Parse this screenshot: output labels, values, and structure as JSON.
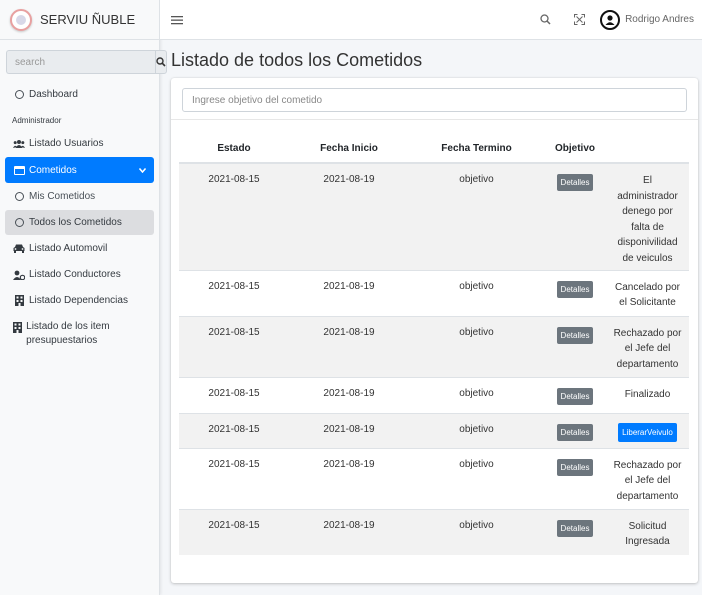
{
  "brand": {
    "name": "SERVIU ÑUBLE"
  },
  "search": {
    "placeholder": "search"
  },
  "sidebar": {
    "items": [
      {
        "label": "Dashboard"
      },
      {
        "header": "Administrador"
      },
      {
        "label": "Listado Usuarios"
      },
      {
        "label": "Cometidos"
      },
      {
        "label": "Mis Cometidos"
      },
      {
        "label": "Todos los Cometidos"
      },
      {
        "label": "Listado Automovil"
      },
      {
        "label": "Listado Conductores"
      },
      {
        "label": "Listado Dependencias"
      },
      {
        "label": "Listado de los item presupuestarios"
      }
    ]
  },
  "topbar": {
    "user_name": "Rodrigo Andres"
  },
  "page": {
    "title": "Listado de todos los Cometidos"
  },
  "filter": {
    "placeholder": "Ingrese objetivo del cometido"
  },
  "table": {
    "headers": [
      "Estado",
      "Fecha Inicio",
      "Fecha Termino",
      "Objetivo",
      ""
    ],
    "rows": [
      {
        "estado": "2021-08-15",
        "inicio": "2021-08-19",
        "termino": "objetivo",
        "button": "Detalles",
        "status": "El administrador denego por falta de disponivilidad de veiculos"
      },
      {
        "estado": "2021-08-15",
        "inicio": "2021-08-19",
        "termino": "objetivo",
        "button": "Detalles",
        "status": "Cancelado por el Solicitante"
      },
      {
        "estado": "2021-08-15",
        "inicio": "2021-08-19",
        "termino": "objetivo",
        "button": "Detalles",
        "status": "Rechazado por el Jefe del departamento"
      },
      {
        "estado": "2021-08-15",
        "inicio": "2021-08-19",
        "termino": "objetivo",
        "button": "Detalles",
        "status": "Finalizado"
      },
      {
        "estado": "2021-08-15",
        "inicio": "2021-08-19",
        "termino": "objetivo",
        "button": "Detalles",
        "action": "LiberarVeivulo"
      },
      {
        "estado": "2021-08-15",
        "inicio": "2021-08-19",
        "termino": "objetivo",
        "button": "Detalles",
        "status": "Rechazado por el Jefe del departamento"
      },
      {
        "estado": "2021-08-15",
        "inicio": "2021-08-19",
        "termino": "objetivo",
        "button": "Detalles",
        "status": "Solicitud Ingresada"
      }
    ]
  },
  "colors": {
    "primary": "#007bff",
    "secondary": "#6c757d",
    "stripe": "#f2f2f2"
  },
  "icons": [
    "hamburger-icon",
    "search-icon",
    "expand-icon",
    "user-circle-icon",
    "users-icon",
    "envelope-icon",
    "car-icon",
    "driver-icon",
    "building-icon",
    "circle-icon"
  ]
}
